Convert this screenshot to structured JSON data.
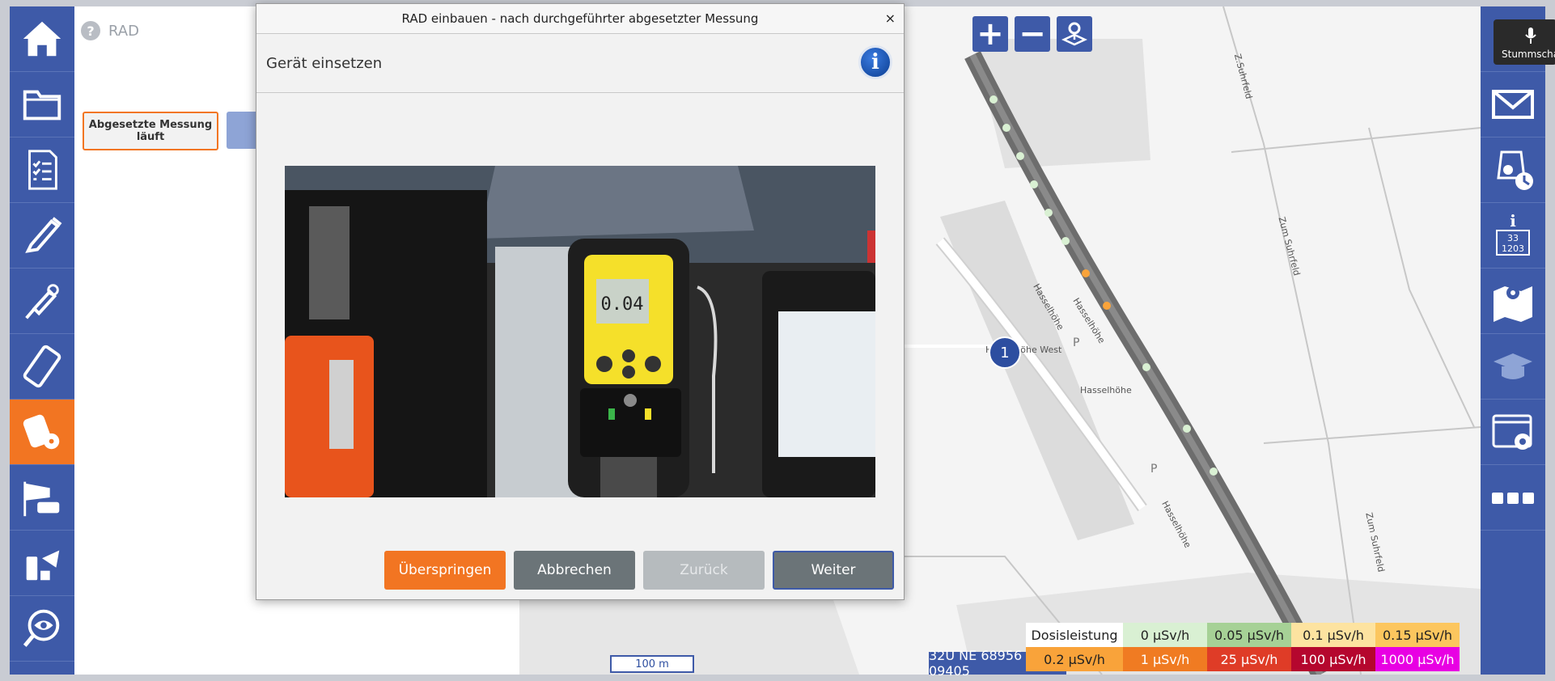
{
  "left_nav": [
    {
      "name": "home",
      "icon": "home-icon"
    },
    {
      "name": "folder",
      "icon": "folder-icon"
    },
    {
      "name": "checklist",
      "icon": "checklist-icon"
    },
    {
      "name": "probe",
      "icon": "probe-icon"
    },
    {
      "name": "sensor",
      "icon": "sensor-icon"
    },
    {
      "name": "handheld",
      "icon": "handheld-device-icon"
    },
    {
      "name": "radiation",
      "icon": "radiation-device-icon",
      "active": true
    },
    {
      "name": "wind",
      "icon": "wind-icon"
    },
    {
      "name": "sampling",
      "icon": "sampling-icon"
    },
    {
      "name": "observe",
      "icon": "eye-icon"
    }
  ],
  "header": {
    "help": "?",
    "title": "RAD"
  },
  "status_button": "Abgesetzte Messung läuft",
  "dialog": {
    "title": "RAD einbauen - nach durchgeführter abgesetzter Messung",
    "close": "×",
    "subtitle": "Gerät einsetzen",
    "info": "i",
    "buttons": {
      "skip": "Überspringen",
      "cancel": "Abbrechen",
      "back": "Zurück",
      "next": "Weiter"
    }
  },
  "map": {
    "zoom_in": "+",
    "zoom_out": "−",
    "marker": "1",
    "scale": "100 m",
    "coordinates": "32U NE 68956 09405",
    "streets": {
      "s1": "Hasselhöhe",
      "s2": "Hasselhöhe West",
      "s3": "Hasselhöhe",
      "s4": "Hasselhöhe",
      "s5": "Hasselhöhe",
      "s6": "Zum Suhrfeld",
      "s7": "Zum Suhrfeld",
      "s8": "Z.Suhrfeld"
    },
    "legend": {
      "label": "Dosisleistung",
      "levels": [
        {
          "text": "0 µSv/h",
          "color": "#d9f0d3"
        },
        {
          "text": "0.05 µSv/h",
          "color": "#a6d196"
        },
        {
          "text": "0.1 µSv/h",
          "color": "#fde3a0"
        },
        {
          "text": "0.15 µSv/h",
          "color": "#fcc65e"
        },
        {
          "text": "0.2 µSv/h",
          "color": "#f9a33a"
        },
        {
          "text": "1 µSv/h",
          "color": "#f07b22"
        },
        {
          "text": "25 µSv/h",
          "color": "#df3c27"
        },
        {
          "text": "100 µSv/h",
          "color": "#b5072e"
        },
        {
          "text": "1000 µSv/h",
          "color": "#e800e3"
        }
      ]
    }
  },
  "right_nav": [
    {
      "name": "mail",
      "icon": "mail-icon"
    },
    {
      "name": "respirator-timer",
      "icon": "respirator-clock-icon"
    },
    {
      "name": "info-card",
      "icon": "info-number-icon",
      "text": "33 1203"
    },
    {
      "name": "map",
      "icon": "map-pin-icon"
    },
    {
      "name": "training",
      "icon": "graduation-cap-icon"
    },
    {
      "name": "settings",
      "icon": "window-settings-icon"
    },
    {
      "name": "more",
      "icon": "more-icon"
    }
  ],
  "mute_tooltip": "Stummschalten",
  "colors": {
    "sidebar": "#3e5aa8",
    "active": "#f27522",
    "accent_orange": "#f27522",
    "button_gray": "#6b7478"
  }
}
